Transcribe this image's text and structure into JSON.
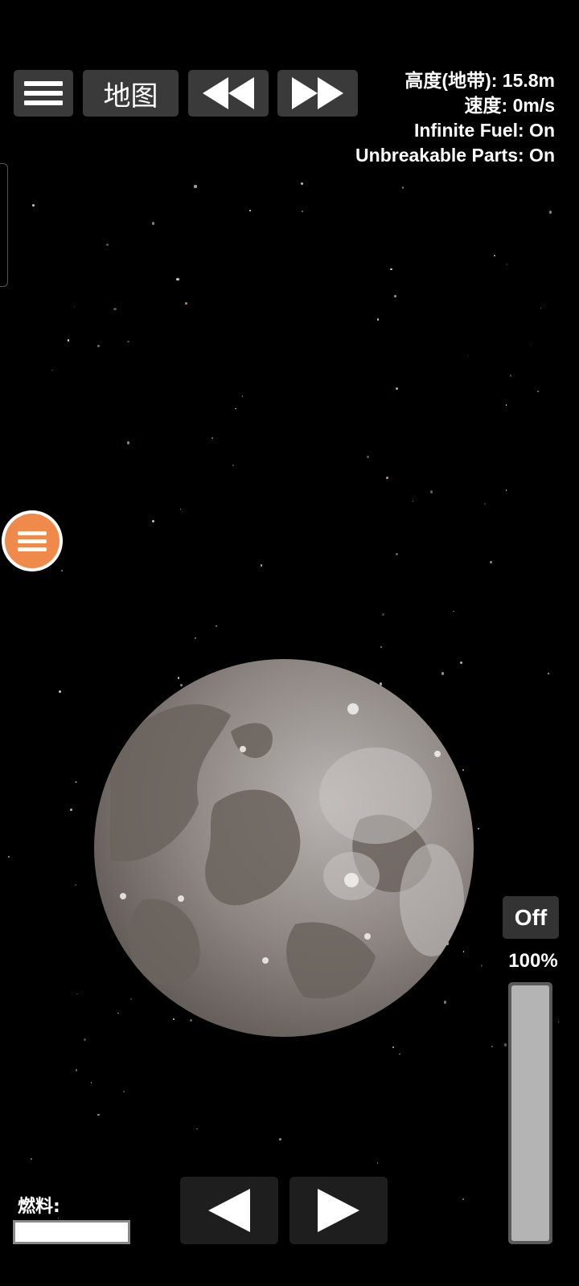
{
  "toolbar": {
    "menu_icon": "hamburger-icon",
    "map_label": "地图",
    "rewind_icon": "rewind-icon",
    "fast_forward_icon": "fast-forward-icon"
  },
  "flight_info": {
    "altitude": "高度(地带): 15.8m",
    "speed": "速度: 0m/s",
    "infinite_fuel": "Infinite Fuel: On",
    "unbreakable_parts": "Unbreakable Parts: On"
  },
  "side_menu_icon": "hamburger-icon",
  "throttle": {
    "toggle_label": "Off",
    "percent_label": "100%",
    "level": 1.0
  },
  "controls": {
    "rotate_left_icon": "triangle-left-icon",
    "rotate_right_icon": "triangle-right-icon"
  },
  "fuel": {
    "label": "燃料:",
    "level": 1.0
  },
  "colors": {
    "background": "#000000",
    "button_bg": "#3a3a3a",
    "accent_orange": "#f08a4b",
    "planet_base": "#8c8581"
  }
}
